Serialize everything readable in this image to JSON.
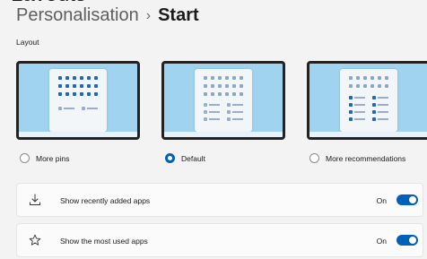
{
  "header": {
    "partial_heading": "Lavouts",
    "breadcrumb": {
      "parent": "Personalisation",
      "separator": "›",
      "current": "Start"
    }
  },
  "layout": {
    "label": "Layout",
    "options": [
      {
        "label": "More pins",
        "selected": false,
        "pin_rows": 3,
        "recommend_rows": 1,
        "pin_color": "#1f66c4"
      },
      {
        "label": "Default",
        "selected": true,
        "pin_rows": 3,
        "recommend_rows": 3,
        "pin_color": "#8aa6c8"
      },
      {
        "label": "More recommendations",
        "selected": false,
        "pin_rows": 2,
        "recommend_rows": 4,
        "pin_color": "#8aa6c8"
      }
    ]
  },
  "settings": [
    {
      "label": "Show recently added apps",
      "state": "On",
      "on": true,
      "icon": "download-icon"
    },
    {
      "label": "Show the most used apps",
      "state": "On",
      "on": true,
      "icon": "star-icon"
    }
  ],
  "colors": {
    "accent": "#005fb8",
    "wallpaper": "#9fd3ef",
    "background": "#f3f3f3"
  }
}
